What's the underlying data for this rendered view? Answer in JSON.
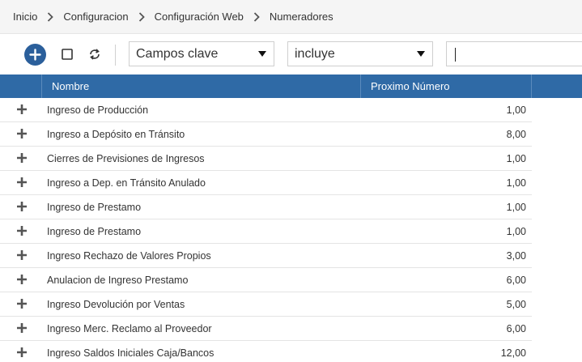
{
  "breadcrumb": {
    "items": [
      "Inicio",
      "Configuracion",
      "Configuración Web",
      "Numeradores"
    ]
  },
  "toolbar": {
    "add_icon": "plus-circle-icon",
    "select_icon": "checkbox-icon",
    "refresh_icon": "refresh-icon",
    "field_select": "Campos clave",
    "operator_select": "incluye",
    "search_value": ""
  },
  "grid": {
    "columns": [
      "Nombre",
      "Proximo Número"
    ],
    "rows": [
      {
        "nombre": "Ingreso de Producción",
        "proximo": "1,00"
      },
      {
        "nombre": "Ingreso a Depósito en Tránsito",
        "proximo": "8,00"
      },
      {
        "nombre": "Cierres de Previsiones de Ingresos",
        "proximo": "1,00"
      },
      {
        "nombre": "Ingreso a Dep. en Tránsito Anulado",
        "proximo": "1,00"
      },
      {
        "nombre": "Ingreso de Prestamo",
        "proximo": "1,00"
      },
      {
        "nombre": "Ingreso de Prestamo",
        "proximo": "1,00"
      },
      {
        "nombre": "Ingreso Rechazo de Valores Propios",
        "proximo": "3,00"
      },
      {
        "nombre": "Anulacion de Ingreso Prestamo",
        "proximo": "6,00"
      },
      {
        "nombre": "Ingreso Devolución por Ventas",
        "proximo": "5,00"
      },
      {
        "nombre": "Ingreso Merc. Reclamo al Proveedor",
        "proximo": "6,00"
      },
      {
        "nombre": "Ingreso Saldos Iniciales Caja/Bancos",
        "proximo": "12,00"
      }
    ]
  },
  "colors": {
    "header_bg": "#2f6aa6",
    "accent": "#2b5f9b",
    "breadcrumb_bg": "#f5f5f5"
  }
}
